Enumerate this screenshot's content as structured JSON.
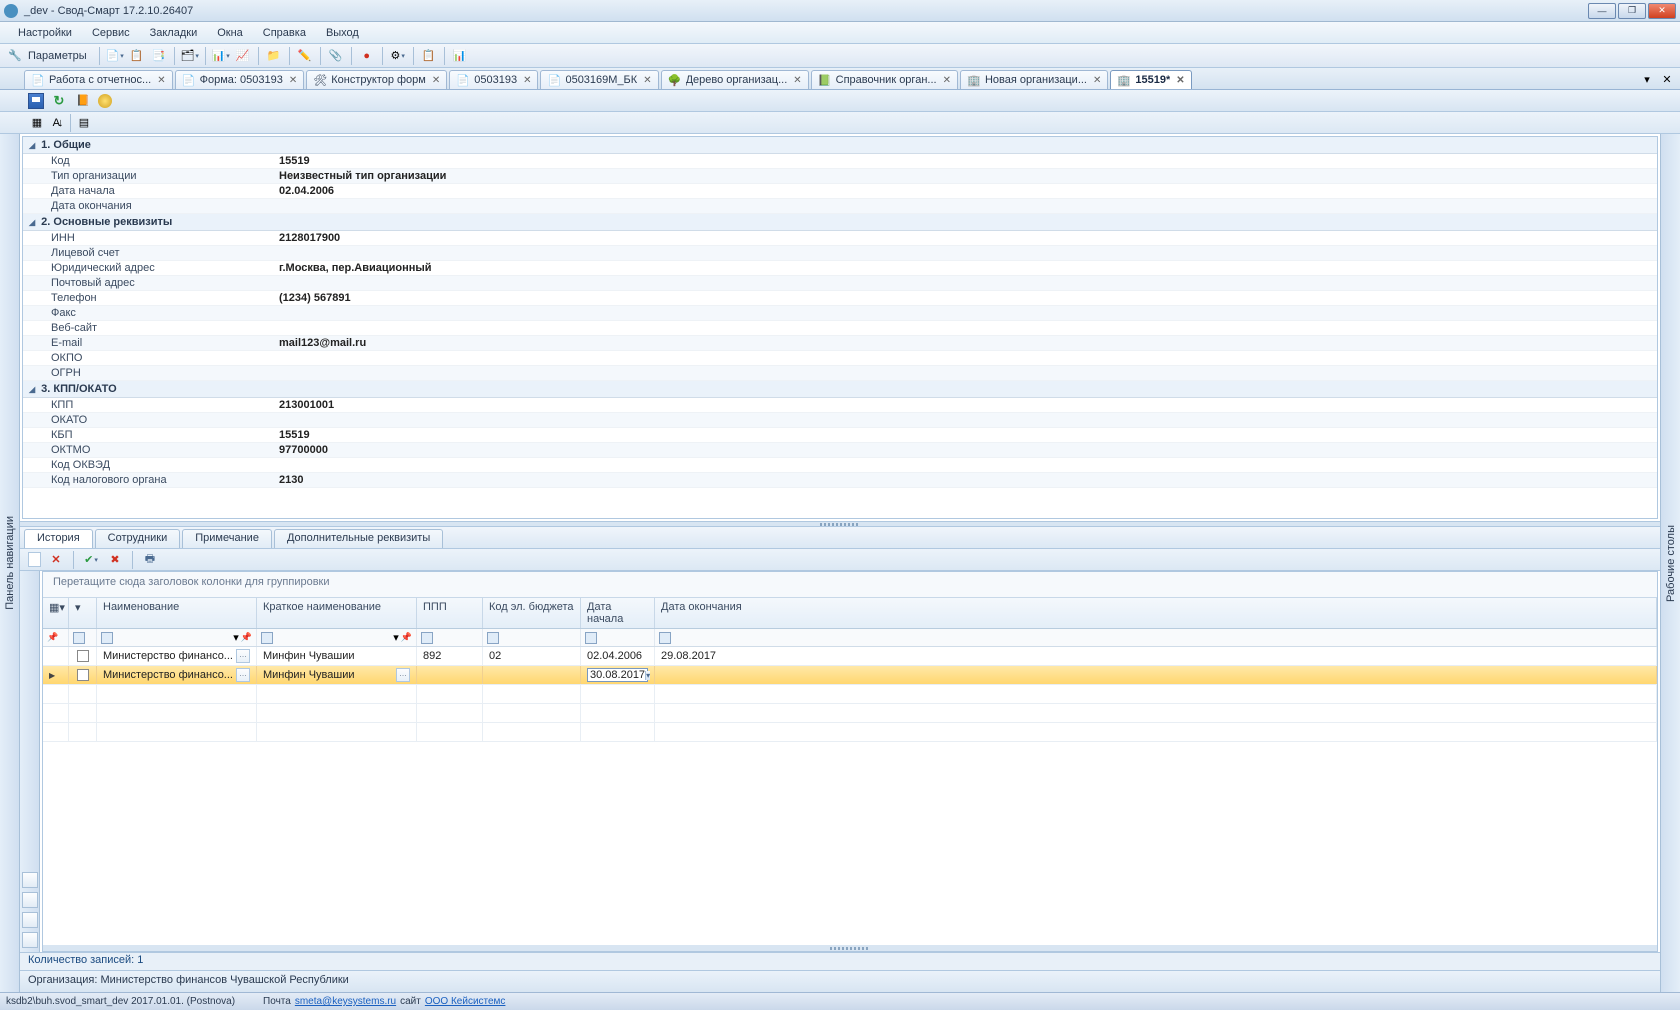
{
  "window": {
    "title": "_dev - Свод-Смарт 17.2.10.26407"
  },
  "menu": [
    "Настройки",
    "Сервис",
    "Закладки",
    "Окна",
    "Справка",
    "Выход"
  ],
  "toolbar1": {
    "params": "Параметры"
  },
  "tabs": [
    {
      "label": "Работа с отчетнос...",
      "active": false
    },
    {
      "label": "Форма: 0503193",
      "active": false
    },
    {
      "label": "Конструктор форм",
      "active": false
    },
    {
      "label": "0503193",
      "active": false
    },
    {
      "label": "0503169М_БК",
      "active": false
    },
    {
      "label": "Дерево организац...",
      "active": false
    },
    {
      "label": "Справочник орган...",
      "active": false
    },
    {
      "label": "Новая организаци...",
      "active": false
    },
    {
      "label": "15519*",
      "active": true
    }
  ],
  "sidepanels": {
    "left": "Панель навигации",
    "right": "Рабочие столы"
  },
  "props": {
    "sections": [
      {
        "title": "1. Общие",
        "rows": [
          {
            "k": "Код",
            "v": "15519"
          },
          {
            "k": "Тип организации",
            "v": "Неизвестный тип организации"
          },
          {
            "k": "Дата начала",
            "v": "02.04.2006"
          },
          {
            "k": "Дата окончания",
            "v": ""
          }
        ]
      },
      {
        "title": "2. Основные реквизиты",
        "rows": [
          {
            "k": "ИНН",
            "v": "2128017900"
          },
          {
            "k": "Лицевой счет",
            "v": ""
          },
          {
            "k": "Юридический адрес",
            "v": "г.Москва, пер.Авиационный"
          },
          {
            "k": "Почтовый адрес",
            "v": ""
          },
          {
            "k": "Телефон",
            "v": "(1234) 567891"
          },
          {
            "k": "Факс",
            "v": ""
          },
          {
            "k": "Веб-сайт",
            "v": ""
          },
          {
            "k": "E-mail",
            "v": "mail123@mail.ru"
          },
          {
            "k": "ОКПО",
            "v": ""
          },
          {
            "k": "ОГРН",
            "v": ""
          }
        ]
      },
      {
        "title": "3. КПП/ОКАТО",
        "rows": [
          {
            "k": "КПП",
            "v": "213001001"
          },
          {
            "k": "ОКАТО",
            "v": ""
          },
          {
            "k": "КБП",
            "v": "15519"
          },
          {
            "k": "ОКТМО",
            "v": "97700000"
          },
          {
            "k": "Код ОКВЭД",
            "v": ""
          },
          {
            "k": "Код налогового органа",
            "v": "2130"
          }
        ]
      }
    ]
  },
  "bottomTabs": [
    "История",
    "Сотрудники",
    "Примечание",
    "Дополнительные реквизиты"
  ],
  "groupPanel": "Перетащите сюда заголовок колонки для группировки",
  "grid": {
    "columns": [
      "",
      "",
      "",
      "Наименование",
      "Краткое наименование",
      "ППП",
      "Код эл. бюджета",
      "Дата начала",
      "Дата окончания"
    ],
    "rows": [
      {
        "name": "Министерство  финансо...",
        "short": "Минфин Чувашии",
        "ppp": "892",
        "bud": "02",
        "dstart": "02.04.2006",
        "dend": "29.08.2017",
        "sel": false
      },
      {
        "name": "Министерство  финансо...",
        "short": "Минфин Чувашии",
        "ppp": "",
        "bud": "",
        "dstart": "30.08.2017",
        "dend": "",
        "sel": true,
        "editing": true
      }
    ]
  },
  "status": {
    "count": "Количество записей: 1",
    "org": "Организация: Министерство финансов Чувашской Республики"
  },
  "footer": {
    "conn": "ksdb2\\buh.svod_smart_dev 2017.01.01. (Postnova)",
    "mail_label": "Почта",
    "mail": "smeta@keysystems.ru",
    "site_label": "сайт",
    "site": "ООО Кейсистемс"
  }
}
